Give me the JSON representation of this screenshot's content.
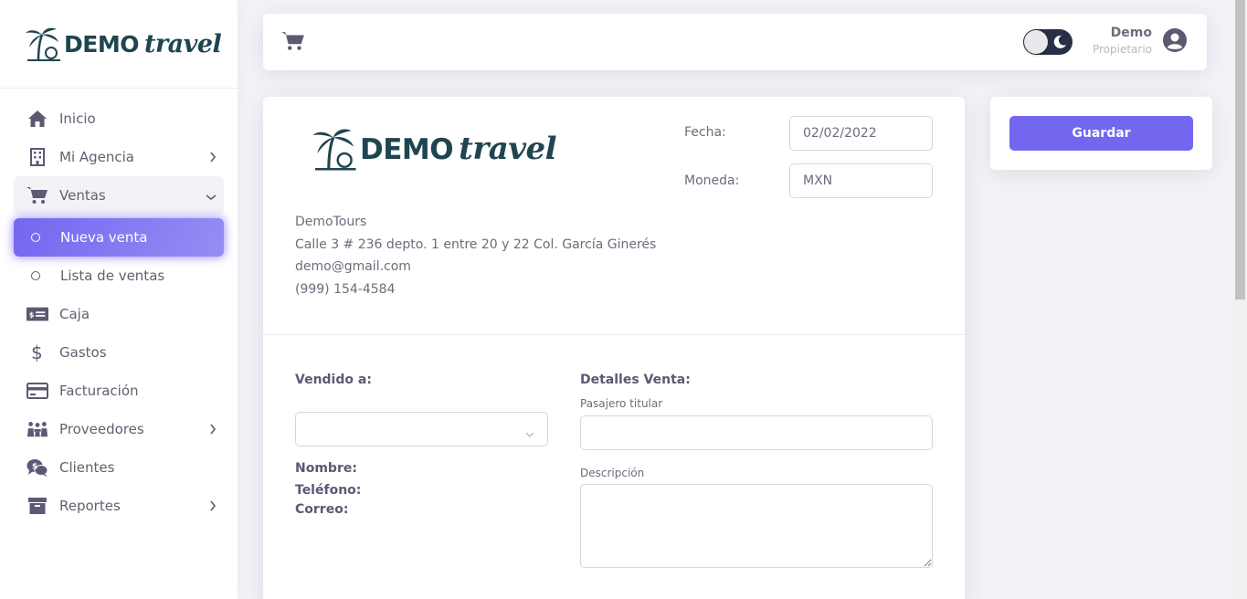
{
  "brand": {
    "logo_word1": "DEMO",
    "logo_word2": "travel"
  },
  "sidebar": {
    "items": [
      {
        "label": "Inicio",
        "icon": "home-icon"
      },
      {
        "label": "Mi Agencia",
        "icon": "building-icon"
      },
      {
        "label": "Ventas",
        "icon": "cart-icon"
      },
      {
        "label": "Nueva venta",
        "icon": "circle-icon"
      },
      {
        "label": "Lista de ventas",
        "icon": "circle-icon"
      },
      {
        "label": "Caja",
        "icon": "cash-icon"
      },
      {
        "label": "Gastos",
        "icon": "dollar-icon"
      },
      {
        "label": "Facturación",
        "icon": "credit-card-icon"
      },
      {
        "label": "Proveedores",
        "icon": "people-icon"
      },
      {
        "label": "Clientes",
        "icon": "comments-dollar-icon"
      },
      {
        "label": "Reportes",
        "icon": "archive-icon"
      }
    ]
  },
  "topbar": {
    "user_name": "Demo",
    "user_role": "Propietario"
  },
  "invoice": {
    "company_name": "DemoTours",
    "address": "Calle 3 # 236 depto. 1 entre 20 y 22 Col. García Ginerés",
    "email": "demo@gmail.com",
    "phone": "(999) 154-4584",
    "date_label": "Fecha:",
    "date_value": "02/02/2022",
    "currency_label": "Moneda:",
    "currency_value": "MXN",
    "sold_to_label": "Vendido a:",
    "name_label": "Nombre:",
    "phone_label": "Teléfono:",
    "email_label": "Correo:",
    "details_label": "Detalles Venta:",
    "passenger_label": "Pasajero titular",
    "description_label": "Descripción"
  },
  "actions": {
    "save_label": "Guardar"
  },
  "colors": {
    "primary": "#7367f0",
    "brand_dark": "#1f4550",
    "text": "#625f6e"
  }
}
